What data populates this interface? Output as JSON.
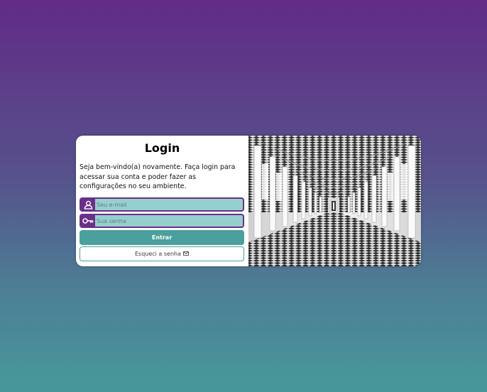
{
  "login": {
    "title": "Login",
    "welcome_text": "Seja bem-vindo(a) novamente. Faça login para acessar sua conta e poder fazer as configurações no seu ambiente.",
    "email": {
      "placeholder": "Seu e-mail",
      "value": "",
      "icon": "user-icon"
    },
    "password": {
      "placeholder": "Sua senha",
      "value": "",
      "icon": "key-icon"
    },
    "submit_label": "Entrar",
    "forgot_label": "Esqueci a senha",
    "forgot_icon": "envelope-icon"
  },
  "colors": {
    "background_top": "#622b87",
    "background_bottom": "#47989a",
    "accent_purple": "#6a2f8a",
    "input_fill": "#96d0ce",
    "button_teal": "#4aa09c"
  }
}
